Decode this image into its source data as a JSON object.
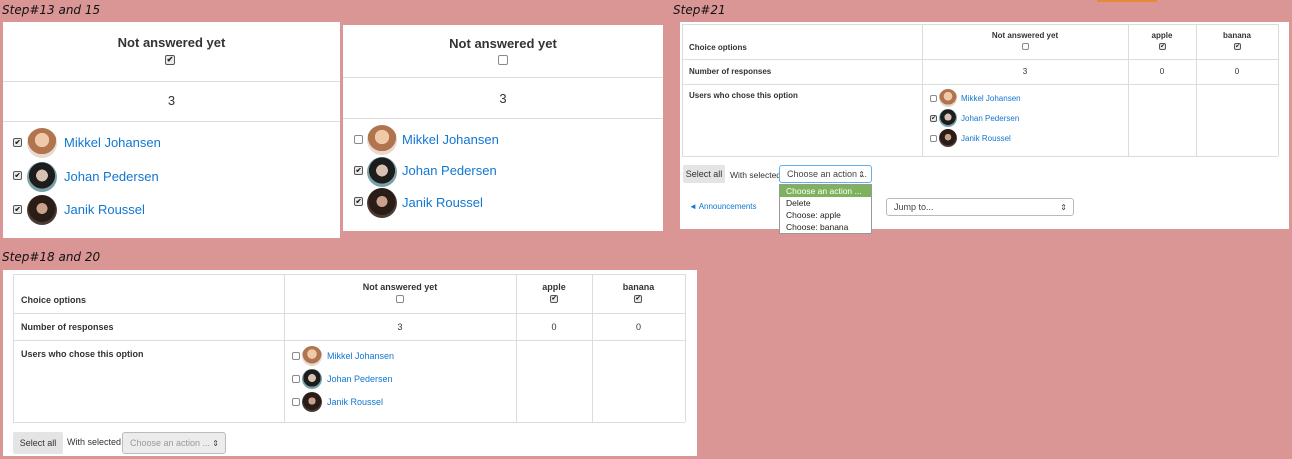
{
  "labels": {
    "step1": "Step#13 and 15",
    "step2": "Step#21",
    "step3": "Step#18 and 20"
  },
  "colors": {
    "background": "#da9595",
    "link": "#1177d1",
    "selected_option": "#7fb25c"
  },
  "users": [
    "Mikkel Johansen",
    "Johan Pedersen",
    "Janik Roussel"
  ],
  "panel_a": {
    "header": "Not answered yet",
    "count": "3",
    "header_checked": true,
    "user_checked": [
      true,
      true,
      true
    ]
  },
  "panel_b": {
    "header": "Not answered yet",
    "count": "3",
    "header_checked": false,
    "user_checked": [
      false,
      true,
      true
    ]
  },
  "panel_c": {
    "row_labels": [
      "Choice options",
      "Number of responses",
      "Users who chose this option"
    ],
    "columns": [
      "Not answered yet",
      "apple",
      "banana"
    ],
    "column_checked": [
      false,
      true,
      true
    ],
    "counts": [
      "3",
      "0",
      "0"
    ],
    "user_checked": [
      false,
      true,
      false
    ],
    "select_all": "Select all",
    "with_selected": "With selected",
    "action_select": "Choose an action ...",
    "dropdown_options": [
      "Choose an action ...",
      "Delete",
      "Choose: apple",
      "Choose: banana"
    ],
    "announcements": "◄ Announcements",
    "jump_to": "Jump to..."
  },
  "panel_d": {
    "row_labels": [
      "Choice options",
      "Number of responses",
      "Users who chose this option"
    ],
    "columns": [
      "Not answered yet",
      "apple",
      "banana"
    ],
    "column_checked": [
      false,
      true,
      true
    ],
    "counts": [
      "3",
      "0",
      "0"
    ],
    "user_checked": [
      false,
      false,
      false
    ],
    "select_all": "Select all",
    "with_selected": "With selected",
    "action_select": "Choose an action ..."
  }
}
